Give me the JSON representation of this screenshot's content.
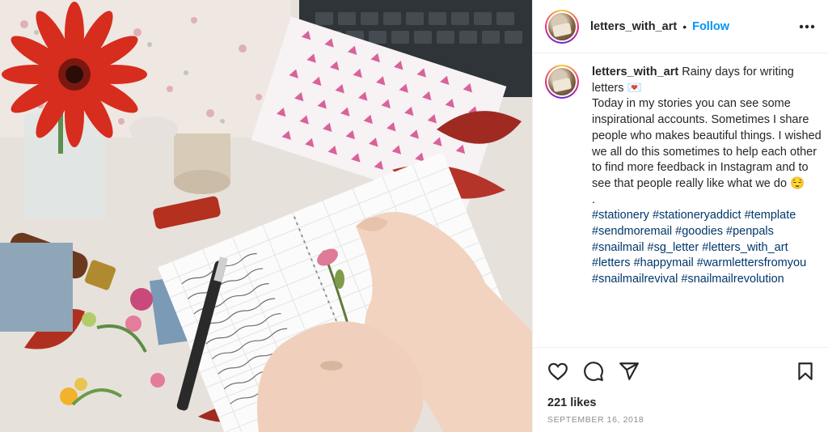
{
  "post": {
    "image_alt": "letters_with_art stationery desk photo",
    "header": {
      "username": "letters_with_art",
      "separator": "•",
      "follow_label": "Follow",
      "more_icon": "more-horizontal-icon"
    },
    "caption": {
      "username": "letters_with_art",
      "text": "Rainy days for writing letters 💌\nToday in my stories you can see some inspirational accounts. Sometimes I share people who makes beautiful things. I wished we all do this sometimes to help each other to find more feedback in Instagram and to see that people really like what we do 😌\n.",
      "hashtags": "#stationery #stationeryaddict #template #sendmoremail #goodies #penpals #snailmail #sg_letter #letters_with_art #letters #happymail #warmlettersfromyou #snailmailrevival #snailmailrevolution"
    },
    "actions": {
      "like_icon": "heart-icon",
      "comment_icon": "comment-icon",
      "share_icon": "paper-plane-icon",
      "save_icon": "bookmark-icon"
    },
    "likes": "221 likes",
    "date": "SEPTEMBER 16, 2018"
  },
  "colors": {
    "follow": "#0095f6",
    "hashtag": "#00376b",
    "muted": "#8e8e8e"
  }
}
